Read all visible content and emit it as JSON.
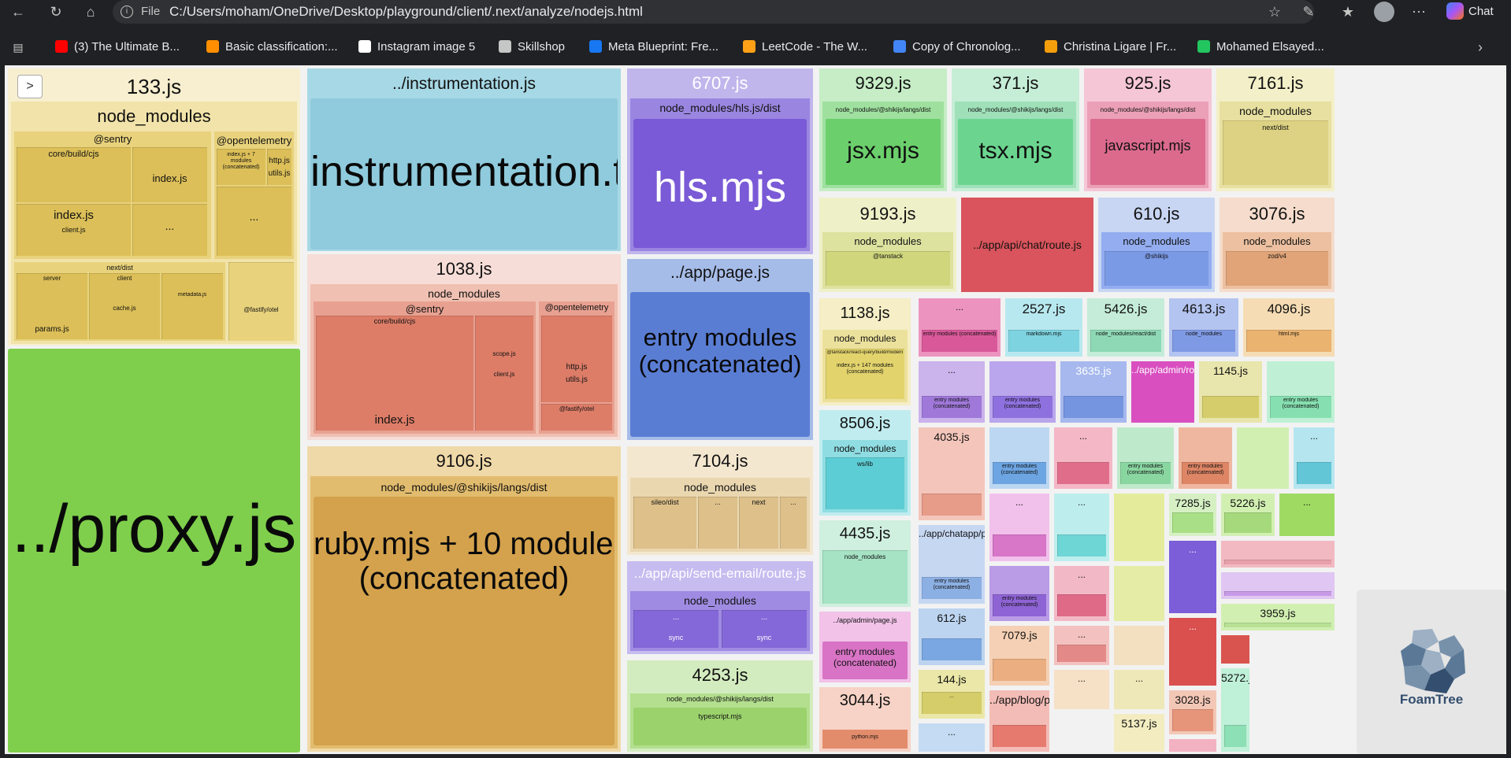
{
  "browser": {
    "address_prefix": "File",
    "url": "C:/Users/moham/OneDrive/Desktop/playground/client/.next/analyze/nodejs.html",
    "copilot_label": "Chat"
  },
  "bookmarks": [
    {
      "label": "(3) The Ultimate B...",
      "icon": "youtube-icon",
      "color": "#ff0000"
    },
    {
      "label": "Basic classification:...",
      "icon": "tensorflow-icon",
      "color": "#ff8f00"
    },
    {
      "label": "Instagram image 5",
      "icon": "triangle-icon",
      "color": "#ffffff"
    },
    {
      "label": "Skillshop",
      "icon": "globe-icon",
      "color": "#c4c7c5"
    },
    {
      "label": "Meta Blueprint: Fre...",
      "icon": "meta-icon",
      "color": "#1877f2"
    },
    {
      "label": "LeetCode - The W...",
      "icon": "leetcode-icon",
      "color": "#ffa116"
    },
    {
      "label": "Copy of Chronolog...",
      "icon": "docs-icon",
      "color": "#4285f4"
    },
    {
      "label": "Christina Ligare | Fr...",
      "icon": "c-icon",
      "color": "#f59e0b"
    },
    {
      "label": "Mohamed Elsayed...",
      "icon": "page-icon",
      "color": "#22c55e"
    }
  ],
  "treemap": {
    "toggle_label": ">",
    "foamtree_label": "FoamTree",
    "col1": {
      "title": "133.js",
      "sub": "node_modules",
      "sentry": "@sentry",
      "otel": "@opentelemetry",
      "labels": [
        "core/build/cjs",
        "index.js",
        "index.js",
        "client.js",
        "http.js",
        "utils.js",
        "index.js + 7 modules (concatenated)",
        "next/dist",
        "server",
        "client",
        "cache.js",
        "metadata.js",
        "params.js",
        "@fastify/otel",
        "utils.js",
        "..."
      ],
      "proxy": "../proxy.js"
    },
    "col2": {
      "instr_title": "../instrumentation.js",
      "instr_inner": "instrumentation.ts",
      "b1038_title": "1038.js",
      "b1038_sub": "node_modules",
      "b1038_sentry": "@sentry",
      "b1038_otel": "@opentelemetry",
      "b1038_labels": [
        "core/build/cjs",
        "index.js",
        "scope.js",
        "client.js",
        "index.js",
        "http.js",
        "utils.js",
        "@fastify/otel",
        "index.js",
        "..."
      ],
      "b9106_title": "9106.js",
      "b9106_sub": "node_modules/@shikijs/langs/dist",
      "b9106_inner1": "ruby.mjs + 10 modules",
      "b9106_inner2": "(concatenated)"
    },
    "col3": {
      "b6707_title": "6707.js",
      "b6707_sub": "node_modules/hls.js/dist",
      "b6707_inner": "hls.mjs",
      "page_title": "../app/page.js",
      "page_inner1": "entry modules",
      "page_inner2": "(concatenated)",
      "b7104_title": "7104.js",
      "b7104_sub": "node_modules",
      "b7104_labels": [
        "sileo/dist",
        "...",
        "next",
        "..."
      ],
      "email_title": "../app/api/send-email/route.js",
      "email_sub": "node_modules",
      "email_labels": [
        "...",
        "...",
        "sync",
        "sync"
      ],
      "b4253_title": "4253.js",
      "b4253_sub": "node_modules/@shikijs/langs/dist",
      "b4253_inner": "typescript.mjs"
    },
    "right": {
      "r1": [
        {
          "title": "9329.js",
          "sub": "node_modules/@shikijs/langs/dist",
          "inner": "jsx.mjs"
        },
        {
          "title": "371.js",
          "sub": "node_modules/@shikijs/langs/dist",
          "inner": "tsx.mjs"
        },
        {
          "title": "925.js",
          "sub": "node_modules/@shikijs/langs/dist",
          "inner": "javascript.mjs"
        },
        {
          "title": "7161.js",
          "sub": "node_modules",
          "inner": "next/dist"
        }
      ],
      "r2": [
        {
          "title": "9193.js",
          "sub": "node_modules",
          "inner": "@tanstack"
        },
        {
          "title": "../app/api/chat/route.js"
        },
        {
          "title": "610.js",
          "sub": "node_modules",
          "inner": "@shikijs"
        },
        {
          "title": "3076.js",
          "sub": "node_modules",
          "inner": "zod/v4"
        }
      ],
      "r3": {
        "b1138": {
          "title": "1138.js",
          "sub": "node_modules",
          "inner": "@tanstack/react-query/build/modern",
          "inner2": "index.js + 147 modules (concatenated)"
        },
        "b8506": {
          "title": "8506.js",
          "sub": "node_modules",
          "inner": "ws/lib"
        },
        "b4435": {
          "title": "4435.js",
          "sub": "node_modules"
        },
        "admin": {
          "title": "../app/admin/page.js",
          "inner": "entry modules",
          "inner2": "(concatenated)"
        },
        "b3044": {
          "title": "3044.js",
          "inner": "python.mjs"
        },
        "small": [
          "...",
          "entry modules (concatenated)",
          "2527.js",
          "markdown.mjs",
          "5426.js",
          "node_modules/react/dist",
          "4613.js",
          "node_modules",
          "4096.js",
          "html.mjs",
          "4035.js",
          "3635.js",
          "1145.js",
          "entry modules (concatenated)",
          "612.js",
          "7079.js",
          "144.js",
          "5137.js",
          "7285.js",
          "5226.js",
          "3959.js",
          "3028.js",
          "5272.js",
          "../app/blog/page.js",
          "../app/chatapp/page.js",
          "../app/admin/route.js",
          "..."
        ]
      }
    }
  }
}
